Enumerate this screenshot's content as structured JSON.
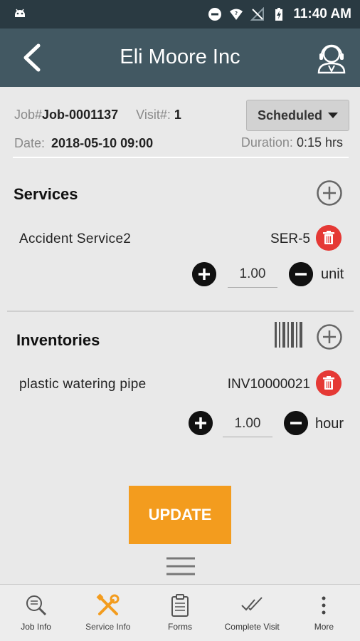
{
  "status_bar": {
    "time": "11:40 AM"
  },
  "app_bar": {
    "title": "Eli Moore Inc"
  },
  "job": {
    "job_label": "Job#",
    "job_number": "Job-0001137",
    "visit_label": "Visit#:",
    "visit_number": "1",
    "status": "Scheduled",
    "date_label": "Date:",
    "date_value": "2018-05-10 09:00",
    "duration_label": "Duration:",
    "duration_value": "0:15 hrs"
  },
  "services": {
    "title": "Services",
    "items": [
      {
        "name": "Accident Service2",
        "code": "SER-5",
        "quantity": "1.00",
        "unit": "unit"
      }
    ]
  },
  "inventories": {
    "title": "Inventories",
    "items": [
      {
        "name": "plastic watering pipe",
        "code": "INV10000021",
        "quantity": "1.00",
        "unit": "hour"
      }
    ]
  },
  "actions": {
    "update_label": "UPDATE"
  },
  "bottom_nav": [
    {
      "label": "Job Info",
      "icon": "search-document-icon"
    },
    {
      "label": "Service Info",
      "icon": "tools-icon",
      "active": true
    },
    {
      "label": "Forms",
      "icon": "clipboard-icon"
    },
    {
      "label": "Complete Visit",
      "icon": "double-check-icon"
    },
    {
      "label": "More",
      "icon": "more-vert-icon"
    }
  ],
  "colors": {
    "app_bar": "#425862",
    "status_bar": "#2a3a42",
    "accent": "#f39c1e",
    "delete": "#e53935"
  }
}
